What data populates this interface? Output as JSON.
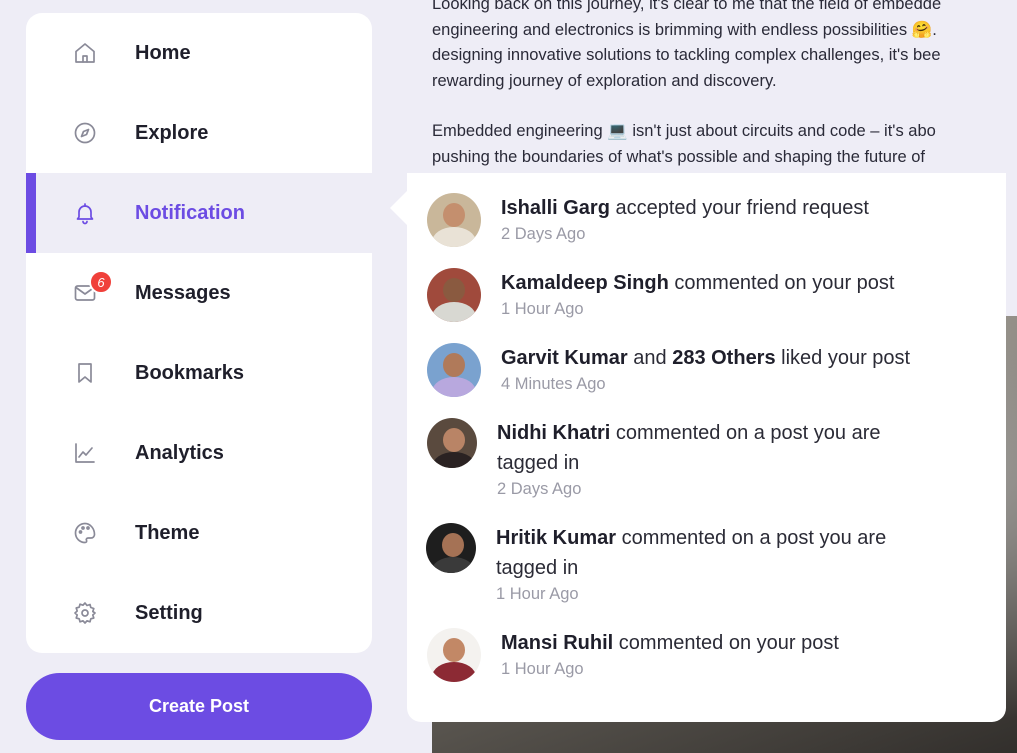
{
  "sidebar": {
    "items": [
      {
        "label": "Home",
        "icon": "home-icon"
      },
      {
        "label": "Explore",
        "icon": "compass-icon"
      },
      {
        "label": "Notification",
        "icon": "bell-icon",
        "active": true
      },
      {
        "label": "Messages",
        "icon": "mail-icon",
        "badge": "6"
      },
      {
        "label": "Bookmarks",
        "icon": "bookmark-icon"
      },
      {
        "label": "Analytics",
        "icon": "chart-icon"
      },
      {
        "label": "Theme",
        "icon": "palette-icon"
      },
      {
        "label": "Setting",
        "icon": "gear-icon"
      }
    ]
  },
  "create_post": {
    "label": "Create Post"
  },
  "feed": {
    "lines1": [
      "Looking back on this journey, it's clear to me that the field of embedde",
      "engineering and electronics is brimming with endless possibilities 🤗.",
      "designing innovative solutions to tackling complex challenges, it's bee",
      "rewarding journey of exploration and discovery."
    ],
    "lines2": [
      "Embedded engineering 💻 isn't just about circuits and code – it's abo",
      "pushing the boundaries of what's possible and shaping the future of"
    ]
  },
  "notifications": [
    {
      "name": "Ishalli Garg",
      "extra": "",
      "action": " accepted your friend request",
      "action2": "",
      "time": "2 Days Ago"
    },
    {
      "name": "Kamaldeep Singh",
      "extra": "",
      "action": " commented on your post",
      "action2": "",
      "time": "1 Hour Ago"
    },
    {
      "name": "Garvit Kumar",
      "mid": " and ",
      "extra": "283 Others",
      "action": " liked your post",
      "action2": "",
      "time": "4 Minutes Ago"
    },
    {
      "name": "Nidhi Khatri",
      "extra": "",
      "action": " commented on a post you are",
      "action2": "tagged in",
      "time": "2 Days Ago"
    },
    {
      "name": "Hritik Kumar",
      "extra": "",
      "action": " commented on a post you are",
      "action2": "tagged in",
      "time": "1 Hour Ago"
    },
    {
      "name": "Mansi Ruhil",
      "extra": "",
      "action": " commented on your post",
      "action2": "",
      "time": "1 Hour Ago"
    }
  ],
  "colors": {
    "accent": "#6c4ce3",
    "badge": "#f0403a",
    "background": "#eeedf6"
  }
}
